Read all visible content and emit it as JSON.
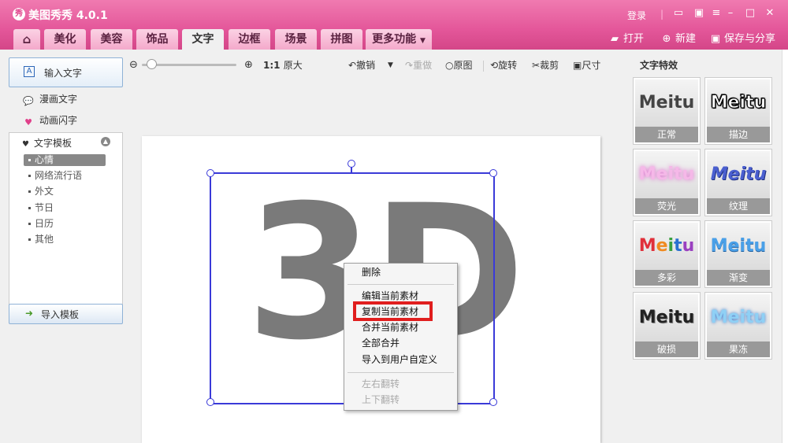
{
  "app": {
    "logo": "秀",
    "title": "美图秀秀 4.0.1"
  },
  "window_controls": {
    "login": "登录",
    "icons": [
      "feedback-icon",
      "skin-icon",
      "menu-icon",
      "minimize-icon",
      "maximize-icon",
      "close-icon"
    ]
  },
  "tabs": [
    "美化",
    "美容",
    "饰品",
    "文字",
    "边框",
    "场景",
    "拼图",
    "更多功能"
  ],
  "active_tab": "文字",
  "tab_actions": {
    "open": "打开",
    "new": "新建",
    "save": "保存与分享"
  },
  "left_panel": {
    "input_text": "输入文字",
    "comic_text": "漫画文字",
    "animated_text": "动画闪字",
    "template_header": "文字模板",
    "template_items": [
      "心情",
      "网络流行语",
      "外文",
      "节日",
      "日历",
      "其他"
    ],
    "selected_template": "心情",
    "import_template": "导入模板"
  },
  "toolbar": {
    "ratio": "1:1",
    "original_size": "原大",
    "undo": "撤销",
    "redo": "重做",
    "original": "原图",
    "rotate": "旋转",
    "crop": "裁剪",
    "size": "尺寸"
  },
  "canvas": {
    "text": "3D"
  },
  "context_menu": {
    "delete": "删除",
    "edit": "编辑当前素材",
    "copy": "复制当前素材",
    "merge": "合并当前素材",
    "merge_all": "全部合并",
    "import_custom": "导入到用户自定义",
    "flip_h": "左右翻转",
    "flip_v": "上下翻转"
  },
  "effects": {
    "title": "文字特效",
    "preview_text": "Meitu",
    "items": [
      {
        "label": "正常",
        "color": "#444444"
      },
      {
        "label": "描边",
        "color": "#ffffff"
      },
      {
        "label": "荧光",
        "color": "#f5b8e8"
      },
      {
        "label": "纹理",
        "color": "#4a5fd0"
      },
      {
        "label": "多彩",
        "color": "#e0303a"
      },
      {
        "label": "渐变",
        "color": "#4aa0e8"
      },
      {
        "label": "破损",
        "color": "#222222"
      },
      {
        "label": "果冻",
        "color": "#8fd0f5"
      }
    ]
  },
  "colors": {
    "brand_pink": "#e4579a",
    "selection_blue": "#3a3ad8",
    "highlight_red": "#e01e1e"
  }
}
